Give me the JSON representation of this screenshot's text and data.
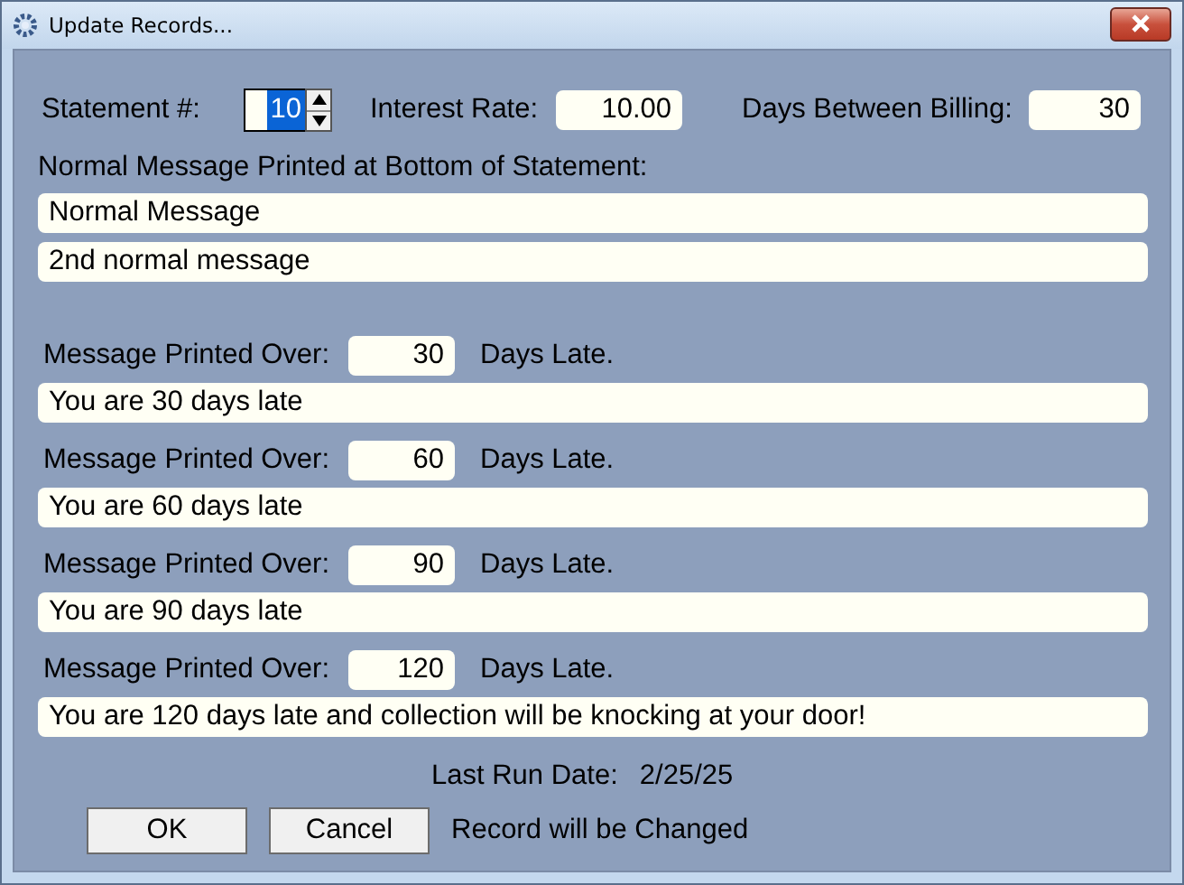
{
  "window": {
    "title": "Update Records..."
  },
  "statement": {
    "label": "Statement #:",
    "value": "10",
    "text_selected": true
  },
  "interest_rate": {
    "label": "Interest Rate:",
    "value": "10.00"
  },
  "days_between_billing": {
    "label": "Days Between Billing:",
    "value": "30"
  },
  "normal_message": {
    "label": "Normal Message Printed at Bottom of Statement:",
    "lines": [
      "Normal Message",
      "2nd normal message"
    ]
  },
  "late_messages": [
    {
      "label": "Message Printed Over:",
      "days": "30",
      "suffix": "Days Late.",
      "message": "You are 30 days late"
    },
    {
      "label": "Message Printed Over:",
      "days": "60",
      "suffix": "Days Late.",
      "message": "You are 60 days late"
    },
    {
      "label": "Message Printed Over:",
      "days": "90",
      "suffix": "Days Late.",
      "message": "You are 90 days late"
    },
    {
      "label": "Message Printed Over:",
      "days": "120",
      "suffix": "Days Late.",
      "message": "You are 120 days late and collection will be knocking at your door!"
    }
  ],
  "last_run": {
    "label": "Last Run Date:",
    "value": "2/25/25"
  },
  "buttons": [
    "OK",
    "Cancel"
  ],
  "status": "Record will be Changed"
}
